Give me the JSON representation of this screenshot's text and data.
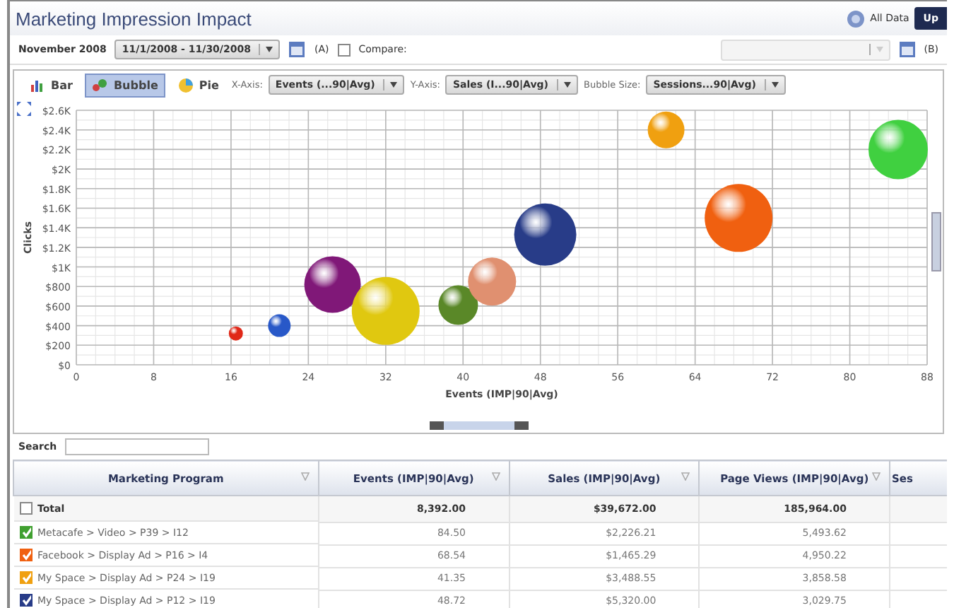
{
  "title": "Marketing Impression Impact",
  "header_actions": {
    "all_data": "All Data",
    "cut_button": "Up"
  },
  "filters": {
    "period_label": "November 2008",
    "date_range": "11/1/2008 - 11/30/2008",
    "range_a": "(A)",
    "compare_label": "Compare:",
    "compare_checked": false,
    "range_b": "(B)"
  },
  "chart_types": [
    {
      "label": "Bar",
      "selected": false
    },
    {
      "label": "Bubble",
      "selected": true
    },
    {
      "label": "Pie",
      "selected": false
    }
  ],
  "axes": [
    {
      "label": "X-Axis:",
      "value": "Events (...90|Avg)"
    },
    {
      "label": "Y-Axis:",
      "value": "Sales (I...90|Avg)"
    },
    {
      "label": "Bubble Size:",
      "value": "Sessions...90|Avg)"
    }
  ],
  "chart": {
    "chart_data": {
      "type": "scatter",
      "xlabel": "Events (IMP|90|Avg)",
      "ylabel": "Clicks",
      "x": [
        16.5,
        21,
        26.5,
        32,
        39.5,
        43,
        48.5,
        61,
        68.5,
        85
      ],
      "grid": true,
      "xlim": [
        0,
        88
      ],
      "ylim": [
        0,
        2600
      ],
      "xticks": [
        0,
        8,
        16,
        24,
        32,
        40,
        48,
        56,
        64,
        72,
        80,
        88
      ],
      "yticks": [
        {
          "value": 0,
          "label": "$0"
        },
        {
          "value": 200,
          "label": "$200"
        },
        {
          "value": 400,
          "label": "$400"
        },
        {
          "value": 600,
          "label": "$600"
        },
        {
          "value": 800,
          "label": "$800"
        },
        {
          "value": 1000,
          "label": "$1K"
        },
        {
          "value": 1200,
          "label": "$1.2K"
        },
        {
          "value": 1400,
          "label": "$1.4K"
        },
        {
          "value": 1600,
          "label": "$1.6K"
        },
        {
          "value": 1800,
          "label": "$1.8K"
        },
        {
          "value": 2000,
          "label": "$2K"
        },
        {
          "value": 2200,
          "label": "$2.2K"
        },
        {
          "value": 2400,
          "label": "$2.4K"
        },
        {
          "value": 2600,
          "label": "$2.6K"
        }
      ],
      "series": [
        {
          "color": "#e02818",
          "values": [
            320,
            null,
            null,
            null,
            null,
            null,
            null,
            null,
            null,
            null
          ]
        },
        {
          "color": "#2858c8",
          "values": [
            null,
            400,
            null,
            null,
            null,
            null,
            null,
            null,
            null,
            null
          ]
        },
        {
          "color": "#801878",
          "values": [
            null,
            null,
            820,
            null,
            null,
            null,
            null,
            null,
            null,
            null
          ]
        },
        {
          "color": "#e0c810",
          "values": [
            null,
            null,
            null,
            550,
            null,
            null,
            null,
            null,
            null,
            null
          ]
        },
        {
          "color": "#5a8828",
          "values": [
            null,
            null,
            null,
            null,
            610,
            null,
            null,
            null,
            null,
            null
          ]
        },
        {
          "color": "#e09070",
          "values": [
            null,
            null,
            null,
            null,
            null,
            850,
            null,
            null,
            null,
            null
          ]
        },
        {
          "color": "#283c88",
          "values": [
            null,
            null,
            null,
            null,
            null,
            null,
            1330,
            null,
            null,
            null
          ]
        },
        {
          "color": "#f0a010",
          "values": [
            null,
            null,
            null,
            null,
            null,
            null,
            null,
            2400,
            null,
            null
          ]
        },
        {
          "color": "#f06010",
          "values": [
            null,
            null,
            null,
            null,
            null,
            null,
            null,
            null,
            1500,
            null
          ]
        },
        {
          "color": "#40d040",
          "values": [
            null,
            null,
            null,
            null,
            null,
            null,
            null,
            null,
            null,
            2200
          ]
        }
      ]
    }
  },
  "search": {
    "label": "Search"
  },
  "table": {
    "columns": [
      "Marketing Program",
      "Events (IMP|90|Avg)",
      "Sales (IMP|90|Avg)",
      "Page Views (IMP|90|Avg)",
      "Ses"
    ],
    "total": {
      "checked": false,
      "cells": [
        "Total",
        "8,392.00",
        "$39,672.00",
        "185,964.00"
      ]
    },
    "rows": [
      {
        "checked": true,
        "color": "#40a030",
        "cells": [
          "Metacafe > Video > P39 > I12",
          "84.50",
          "$2,226.21",
          "5,493.62"
        ]
      },
      {
        "checked": true,
        "color": "#f06010",
        "cells": [
          "Facebook > Display Ad > P16 > I4",
          "68.54",
          "$1,465.29",
          "4,950.22"
        ]
      },
      {
        "checked": true,
        "color": "#f0a010",
        "cells": [
          "My Space > Display Ad > P24 > I19",
          "41.35",
          "$3,488.55",
          "3,858.58"
        ]
      },
      {
        "checked": true,
        "color": "#283c88",
        "cells": [
          "My Space > Display Ad > P12 > I19",
          "48.72",
          "$5,320.00",
          "3,029.75"
        ]
      }
    ]
  }
}
